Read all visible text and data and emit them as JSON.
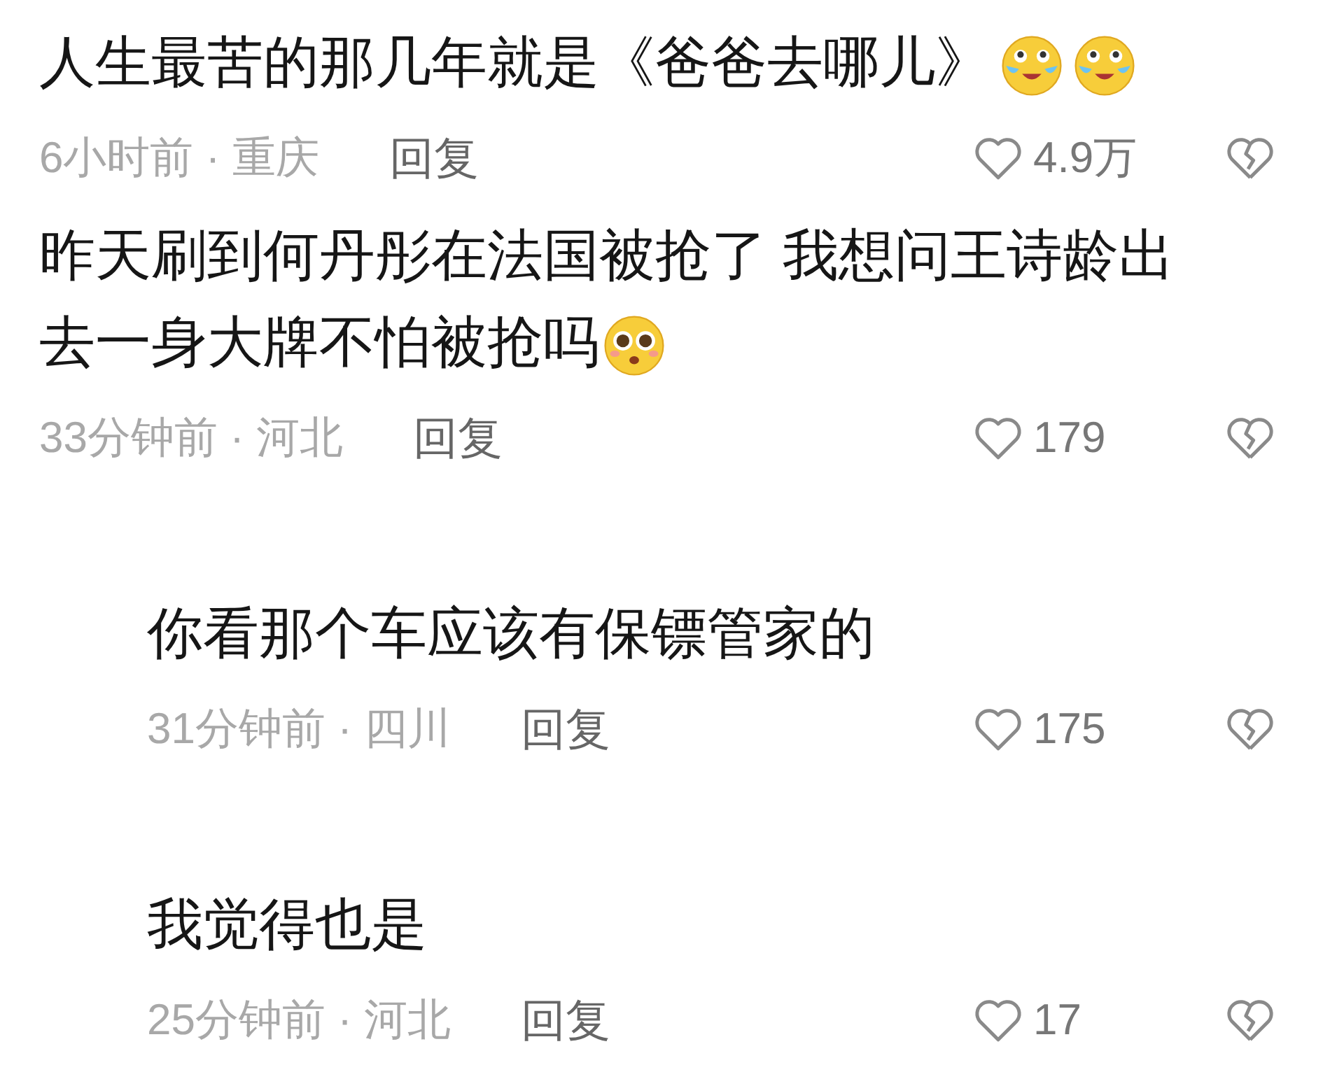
{
  "comments": [
    {
      "kind": "comment",
      "text": "人生最苦的那几年就是《爸爸去哪儿》",
      "emojis": [
        {
          "kind": "tears"
        },
        {
          "kind": "tears"
        }
      ],
      "meta": "6小时前 · 重庆",
      "reply": "回复",
      "likes": "4.9万"
    },
    {
      "kind": "comment",
      "text": "昨天刷到何丹彤在法国被抢了 我想问王诗龄出去一身大牌不怕被抢吗",
      "emojis": [
        {
          "kind": "pleading"
        }
      ],
      "meta": "33分钟前 · 河北",
      "reply": "回复",
      "likes": "179"
    },
    {
      "kind": "reply",
      "text": "你看那个车应该有保镖管家的",
      "meta": "31分钟前 · 四川",
      "reply": "回复",
      "likes": "175"
    },
    {
      "kind": "reply",
      "text": "我觉得也是",
      "meta": "25分钟前 · 河北",
      "reply": "回复",
      "likes": "17"
    }
  ]
}
